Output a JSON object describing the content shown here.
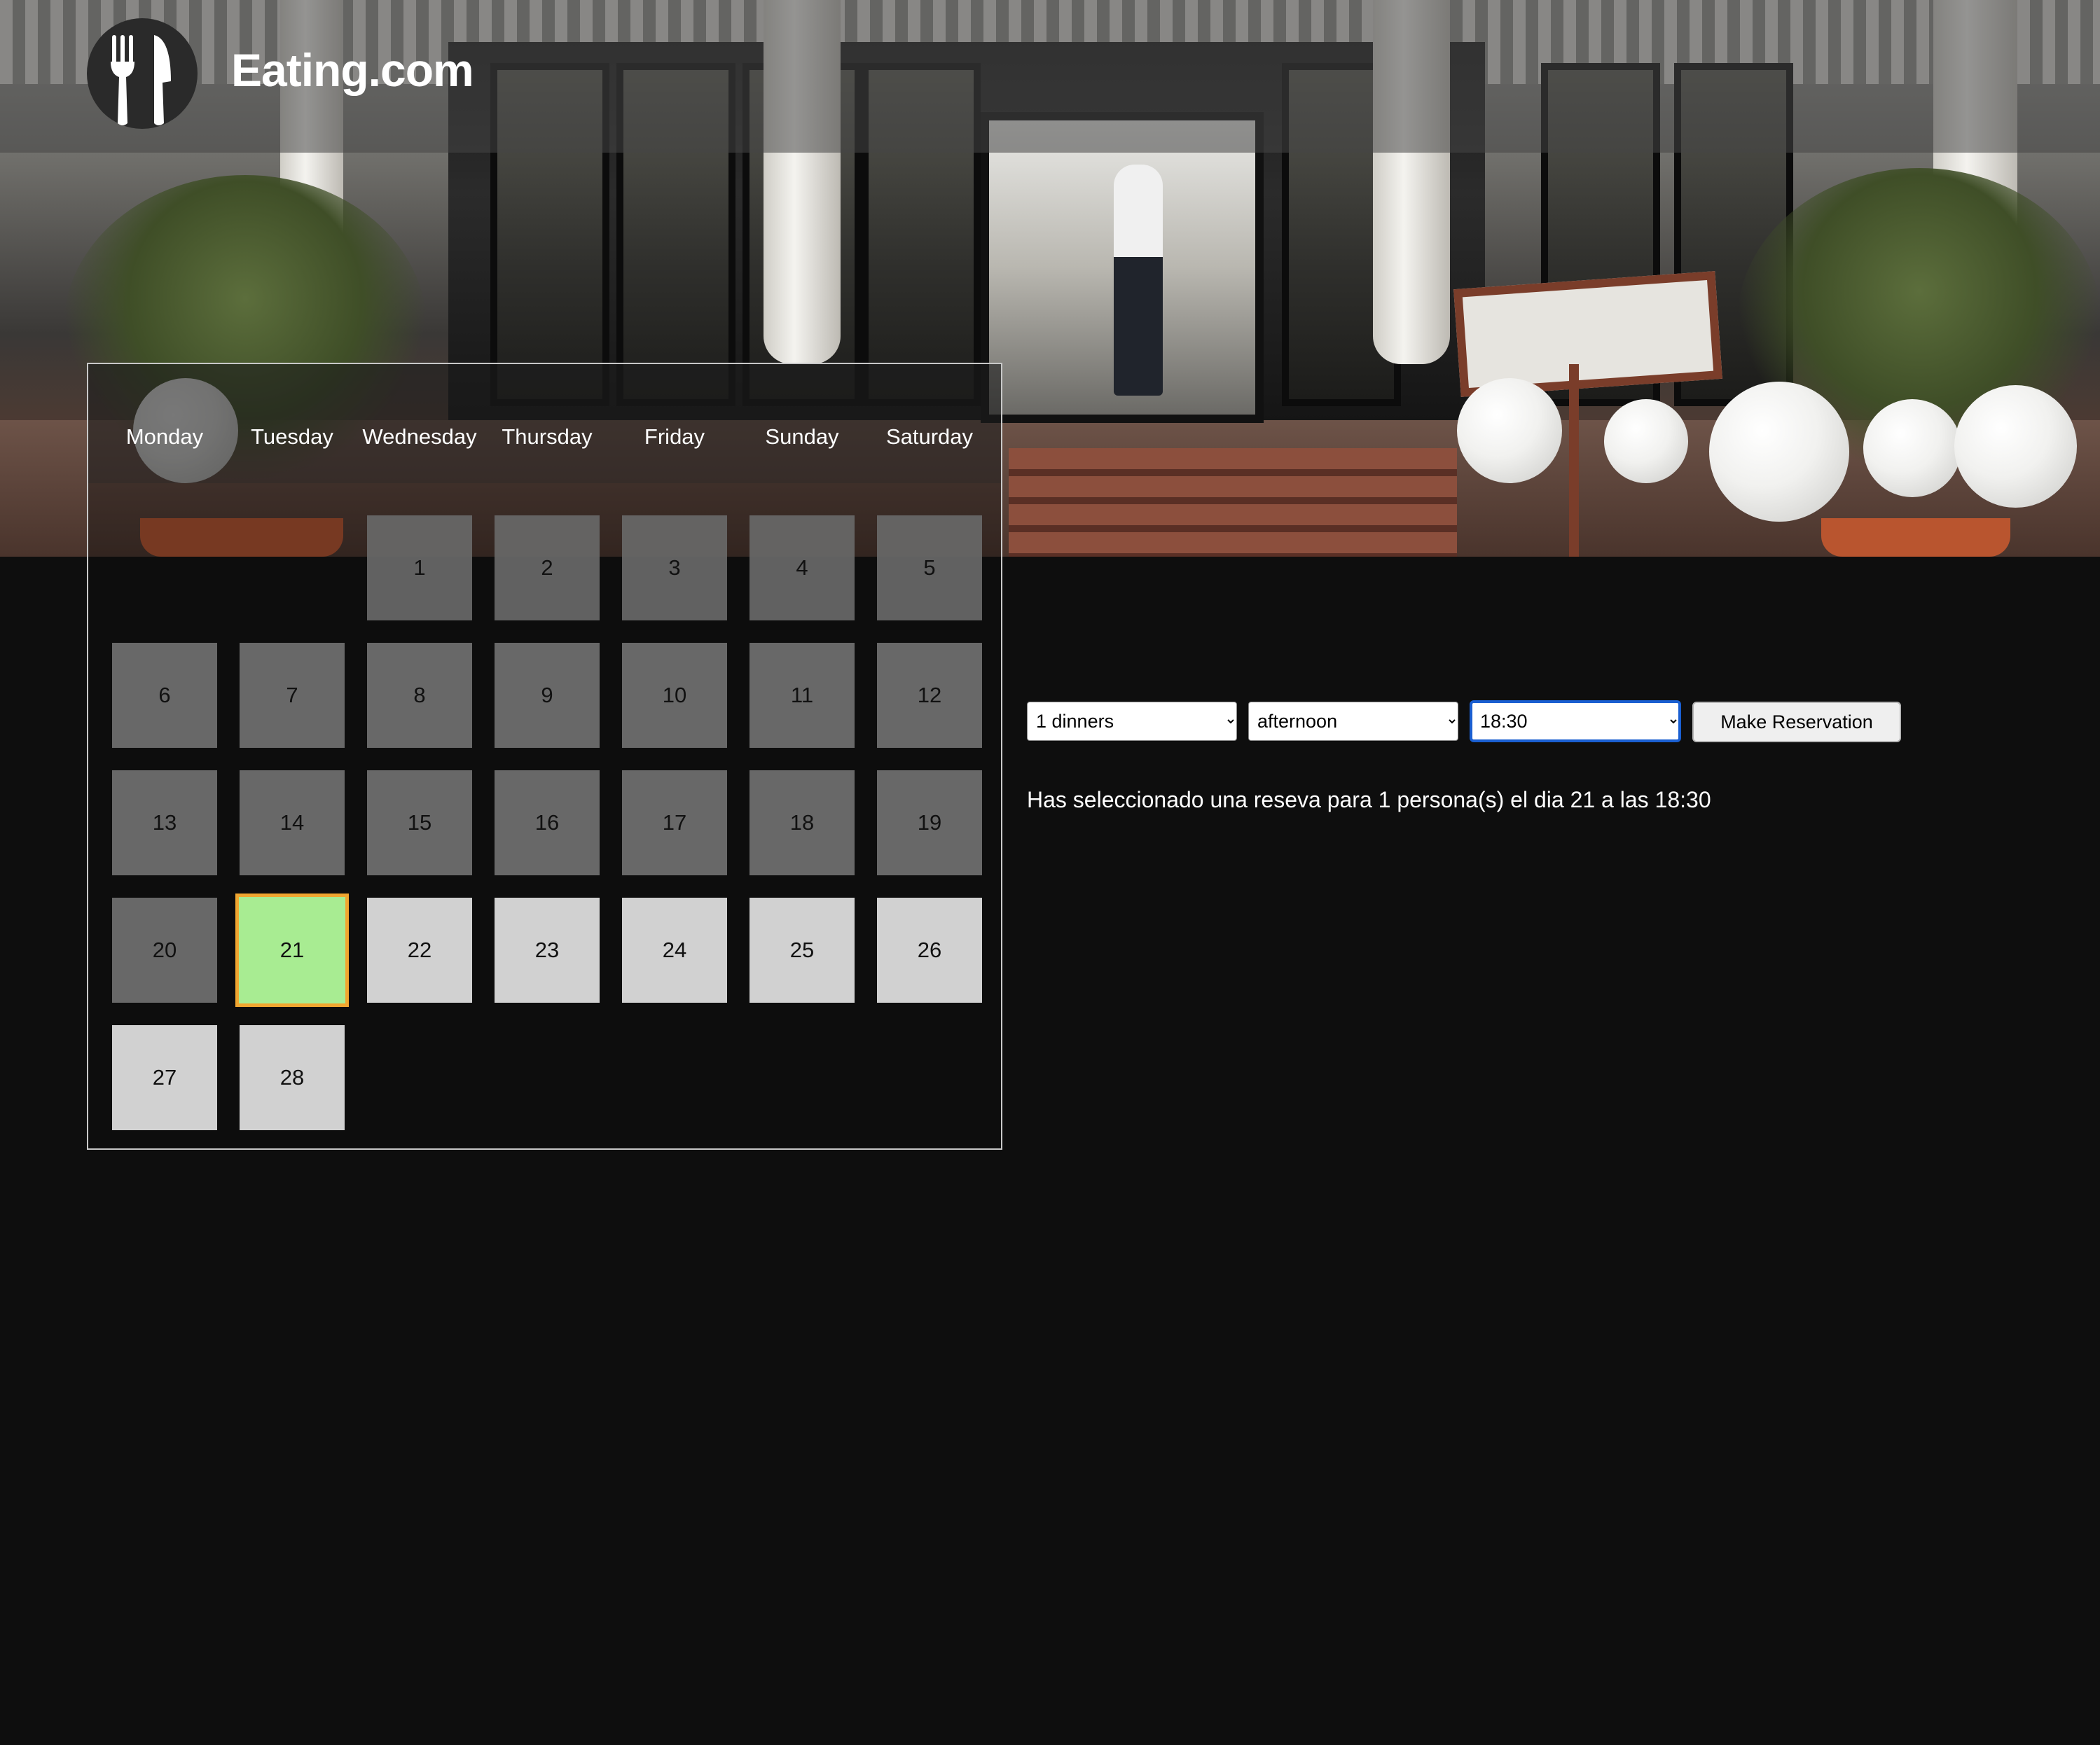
{
  "header": {
    "brand": "Eating.com",
    "logo_icon": "fork-knife-icon"
  },
  "hero": {
    "image": "restaurant-storefront-photo"
  },
  "calendar": {
    "weekdays": [
      "Monday",
      "Tuesday",
      "Wednesday",
      "Thursday",
      "Friday",
      "Sunday",
      "Saturday"
    ],
    "days": [
      "1",
      "2",
      "3",
      "4",
      "5",
      "6",
      "7",
      "8",
      "9",
      "10",
      "11",
      "12",
      "13",
      "14",
      "15",
      "16",
      "17",
      "18",
      "19",
      "20",
      "21",
      "22",
      "23",
      "24",
      "25",
      "26",
      "27",
      "28"
    ],
    "selected_day": "21",
    "colors": {
      "past_day": "#686868",
      "future_day": "#d1d1d1",
      "selected_fill": "#a8ec92",
      "selected_border": "#f0a630"
    }
  },
  "reservation": {
    "diners_value": "1 dinners",
    "period_value": "afternoon",
    "time_value": "18:30",
    "button_label": "Make Reservation",
    "summary": "Has seleccionado una reseva para 1 persona(s) el dia 21 a las 18:30"
  }
}
